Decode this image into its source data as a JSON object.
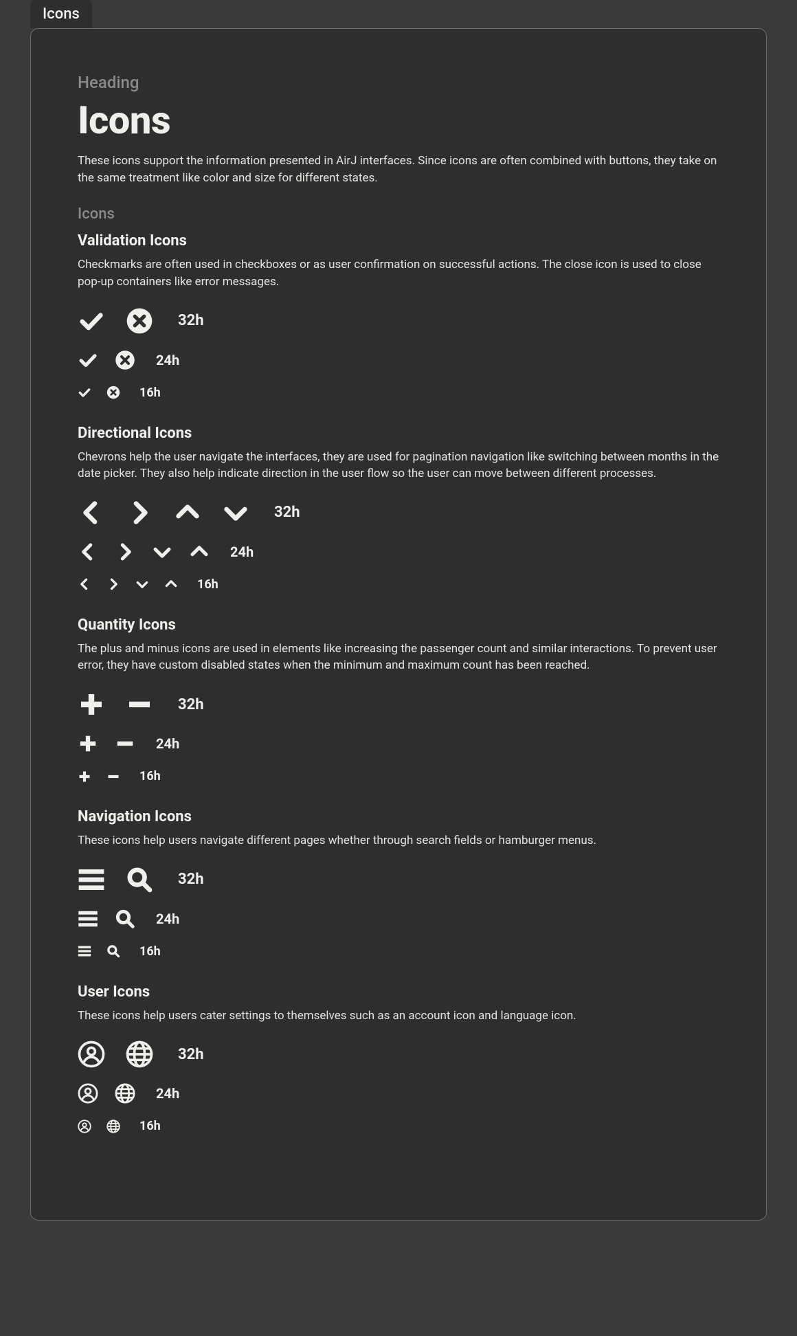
{
  "tab": "Icons",
  "eyebrow": "Heading",
  "title": "Icons",
  "lead": "These icons support the information presented in AirJ interfaces. Since icons are often combined with buttons, they take on the same treatment like color and size for different states.",
  "icons_eyebrow": "Icons",
  "sizes": {
    "lg": "32h",
    "md": "24h",
    "sm": "16h"
  },
  "sections": {
    "validation": {
      "title": "Validation Icons",
      "desc": "Checkmarks are often used in checkboxes or as user confirmation on successful actions. The close icon is used to close pop-up containers like error messages."
    },
    "directional": {
      "title": "Directional Icons",
      "desc": "Chevrons help the user navigate the interfaces, they are used for pagination navigation like switching between months in the date picker. They also help indicate direction in the user flow so the user can move between different processes."
    },
    "quantity": {
      "title": "Quantity Icons",
      "desc": "The plus and minus icons are used in elements like increasing the passenger count and similar interactions. To prevent user error, they have custom disabled states when the minimum and maximum count has been reached."
    },
    "navigation": {
      "title": "Navigation Icons",
      "desc": "These icons help users navigate different pages whether through search fields or hamburger menus."
    },
    "user": {
      "title": "User Icons",
      "desc": "These icons help users cater settings to themselves such as an account icon and language icon."
    }
  }
}
